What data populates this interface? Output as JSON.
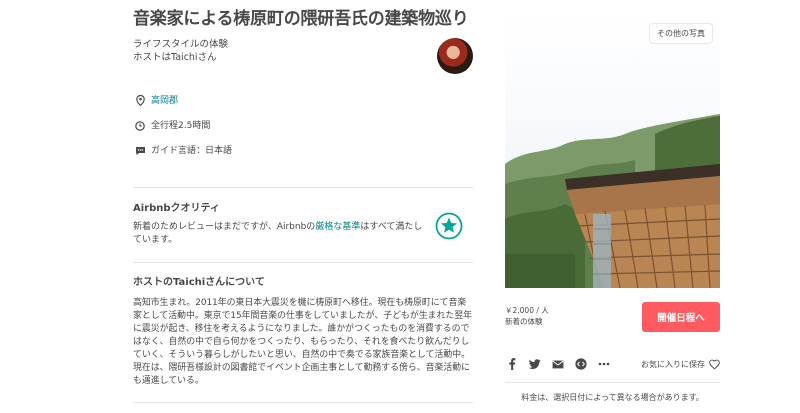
{
  "header": {
    "title": "音楽家による梼原町の隈研吾氏の建築物巡り",
    "subtitle": "ライフスタイルの体験",
    "host_name": "ホストはTaichiさん"
  },
  "info": {
    "location": "高岡郡",
    "duration": "全行程2.5時間",
    "language": "ガイド言語：日本語"
  },
  "quality": {
    "heading": "Airbnbクオリティ",
    "text_before": "新着のためレビューはまだですが、Airbnbの",
    "link": "厳格な基準",
    "text_after": "はすべて満たしています。"
  },
  "about": {
    "heading": "ホストのTaichiさんについて",
    "text": "高知市生まれ。2011年の東日本大震災を機に梼原町へ移住。現在も梼原町にて音楽家として活動中。東京で15年間音楽の仕事をしていましたが、子どもが生まれた翌年に震災が起き、移住を考えるようになりました。誰かがつくったものを消費するのではなく、自然の中で自ら何かをつくったり、もらったり、それを食べたり飲んだりしていく、そういう暮らしがしたいと思い、自然の中で奏でる家族音楽として活動中。現在は、隈研吾様設計の図書館でイベント企画主事として勤務する傍ら、音楽活動にも邁進している。"
  },
  "photo": {
    "more_photos_label": "その他の写真"
  },
  "booking": {
    "price": "￥2,000 / 人",
    "price_note": "新着の体験",
    "button_label": "開催日程へ"
  },
  "share": {
    "icons": [
      "facebook-icon",
      "twitter-icon",
      "email-icon",
      "embed-icon",
      "more-icon"
    ],
    "save_label": "お気に入りに保存"
  },
  "note": "料金は、選択日付によって異なる場合があります。",
  "colors": {
    "accent": "#ff5a5f",
    "link": "#008489",
    "text": "#484848",
    "badge": "#00a699"
  }
}
